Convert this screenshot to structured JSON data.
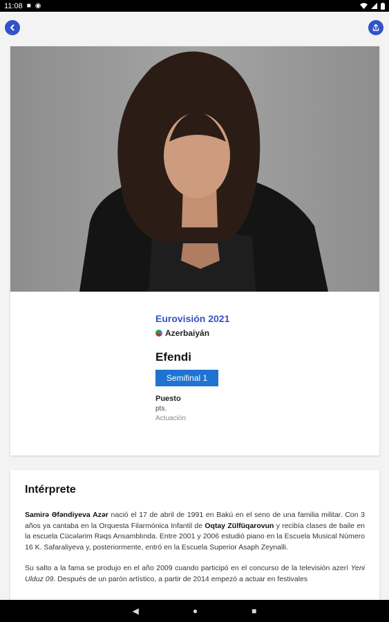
{
  "status_bar": {
    "time": "11:08"
  },
  "hero": {
    "contest": "Eurovisión 2021",
    "country": "Azerbaiyán",
    "song": "Efendi",
    "stage": "Semifinal 1",
    "placing_label": "Puesto",
    "points_text": "pts.",
    "performance_text": "Actuación"
  },
  "bio": {
    "title": "Intérprete",
    "p1_name": "Samirə Əfəndiyeva Azər",
    "p1_a": " nació el 17 de abril de 1991 en Bakú en el seno de una familia militar. Con 3 años ya cantaba en la Orquesta Filarmónica Infantil de ",
    "p1_b": "Oqtay Zülfüqarovun",
    "p1_c": " y recibía clases de baile en la escuela Cücələrim Rəqs Ansamblında. Entre 2001 y 2006 estudió piano en la Escuela Musical Número 16 K. Safaraliyeva y, posteriormente, entró en la Escuela Superior Asaph Zeynalli.",
    "p2_a": "Su salto a la fama se produjo en el año 2009 cuando participó en el concurso de la televisión azerí ",
    "p2_show": "Yeni Ulduz 09",
    "p2_b": ". Después de un parón artístico, a partir de 2014 empezó a actuar en festivales"
  },
  "colors": {
    "accent": "#3352c8",
    "badge": "#1f73d1"
  },
  "icons": [
    "back-arrow-icon",
    "share-icon",
    "flag-icon",
    "nav-back-icon",
    "nav-home-icon",
    "nav-recents-icon"
  ]
}
